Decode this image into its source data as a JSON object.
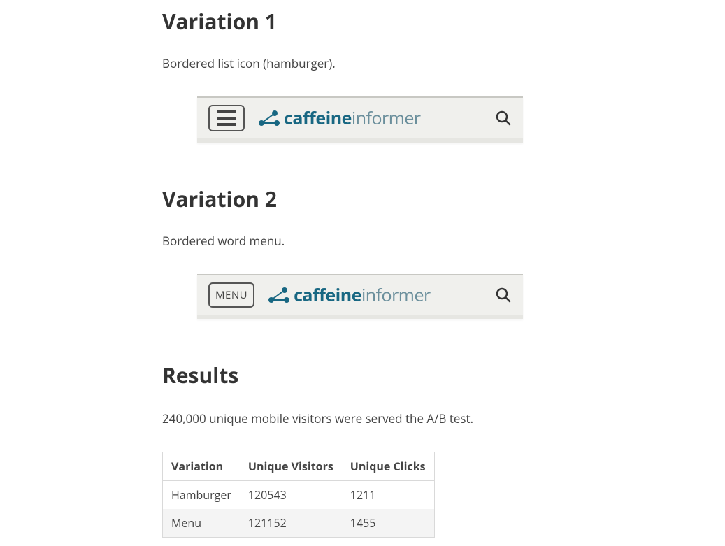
{
  "variation1": {
    "heading": "Variation 1",
    "description": "Bordered list icon (hamburger).",
    "brand_bold": "caffeine",
    "brand_light": "informer"
  },
  "variation2": {
    "heading": "Variation 2",
    "description": "Bordered word menu.",
    "menu_label": "MENU",
    "brand_bold": "caffeine",
    "brand_light": "informer"
  },
  "results": {
    "heading": "Results",
    "description": "240,000 unique mobile visitors were served the A/B test.",
    "columns": [
      "Variation",
      "Unique Visitors",
      "Unique Clicks"
    ],
    "rows": [
      {
        "variation": "Hamburger",
        "visitors": "120543",
        "clicks": "1211"
      },
      {
        "variation": "Menu",
        "visitors": "121152",
        "clicks": "1455"
      }
    ]
  },
  "chart_data": {
    "type": "table",
    "title": "Results",
    "columns": [
      "Variation",
      "Unique Visitors",
      "Unique Clicks"
    ],
    "rows": [
      [
        "Hamburger",
        120543,
        1211
      ],
      [
        "Menu",
        121152,
        1455
      ]
    ]
  }
}
